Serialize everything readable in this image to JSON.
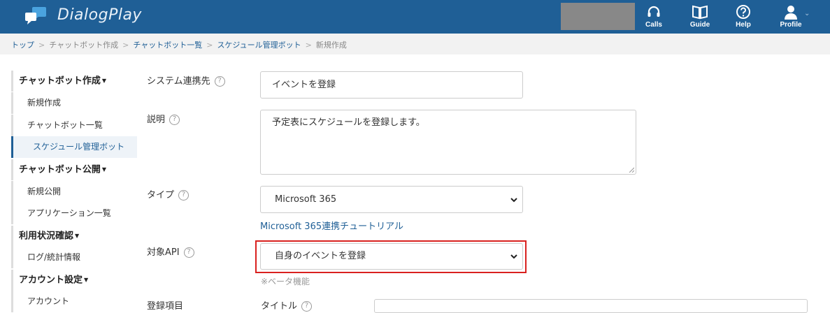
{
  "header": {
    "brand": "DialogPlay",
    "nav": [
      {
        "label": "Calls",
        "icon": "headset-icon"
      },
      {
        "label": "Guide",
        "icon": "book-icon"
      },
      {
        "label": "Help",
        "icon": "question-icon"
      },
      {
        "label": "Profile",
        "icon": "user-icon"
      }
    ],
    "colors": {
      "bar": "#1f5f96"
    }
  },
  "breadcrumb": {
    "items": [
      "トップ",
      "チャットボット作成",
      "チャットボット一覧",
      "スケジュール管理ボット",
      "新規作成"
    ]
  },
  "sidebar": {
    "sections": [
      {
        "title": "チャットボット作成",
        "items": [
          "新規作成",
          "チャットボット一覧",
          "スケジュール管理ボット"
        ]
      },
      {
        "title": "チャットボット公開",
        "items": [
          "新規公開",
          "アプリケーション一覧"
        ]
      },
      {
        "title": "利用状況確認",
        "items": [
          "ログ/統計情報"
        ]
      },
      {
        "title": "アカウント設定",
        "items": [
          "アカウント"
        ]
      }
    ],
    "active": "スケジュール管理ボット"
  },
  "form": {
    "system_label": "システム連携先",
    "system_value": "イベントを登録",
    "description_label": "説明",
    "description_value": "予定表にスケジュールを登録します。",
    "type_label": "タイプ",
    "type_value": "Microsoft 365",
    "tutorial_link": "Microsoft 365連携チュートリアル",
    "api_label": "対象API",
    "api_value": "自身のイベントを登録",
    "beta_note": "※ベータ機能",
    "items_label": "登録項目",
    "title_label": "タイトル"
  }
}
